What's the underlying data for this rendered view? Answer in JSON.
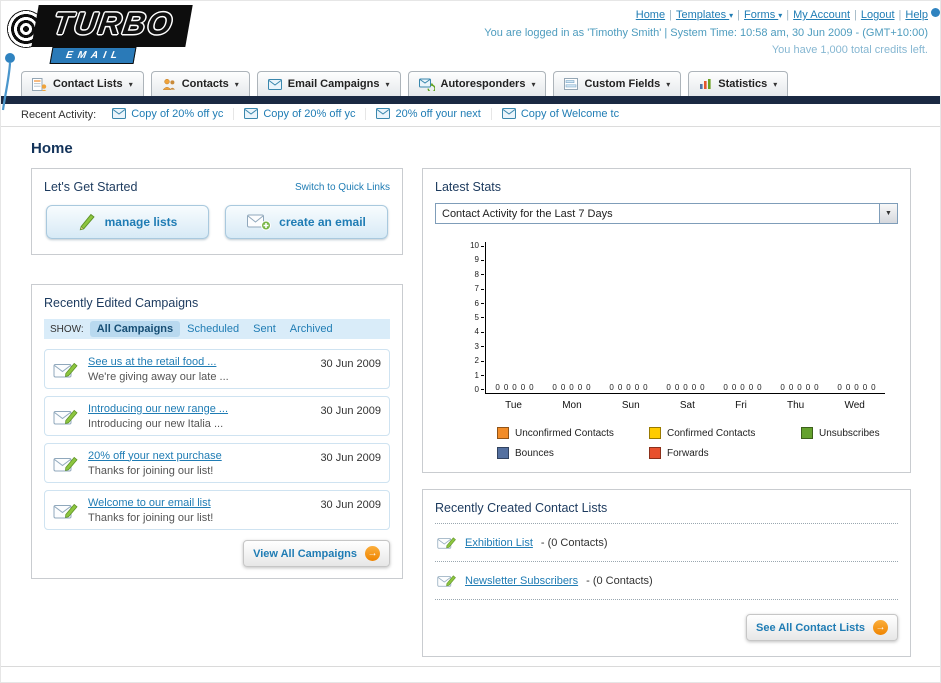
{
  "icons": {
    "caret_down": "▾",
    "select_arrow": "▼",
    "arrow": "→"
  },
  "header": {
    "logo": {
      "title": "TURBO",
      "subtitle": "EMAIL"
    },
    "links": [
      {
        "label": "Home",
        "dropdown": false
      },
      {
        "label": "Templates",
        "dropdown": true
      },
      {
        "label": "Forms",
        "dropdown": true
      },
      {
        "label": "My Account",
        "dropdown": false
      },
      {
        "label": "Logout",
        "dropdown": false
      },
      {
        "label": "Help",
        "dropdown": false
      }
    ],
    "status_line": "You are logged in as 'Timothy Smith' | System Time: 10:58 am, 30 Jun 2009 - (GMT+10:00)",
    "credits_line": "You have 1,000 total credits left."
  },
  "nav_tabs": [
    {
      "label": "Contact Lists",
      "icon": "contact-lists-icon"
    },
    {
      "label": "Contacts",
      "icon": "contacts-icon"
    },
    {
      "label": "Email Campaigns",
      "icon": "email-campaigns-icon"
    },
    {
      "label": "Autoresponders",
      "icon": "autoresponders-icon"
    },
    {
      "label": "Custom Fields",
      "icon": "custom-fields-icon"
    },
    {
      "label": "Statistics",
      "icon": "statistics-icon"
    }
  ],
  "recent_activity": {
    "label": "Recent Activity:",
    "items": [
      "Copy of 20% off yc",
      "Copy of 20% off yc",
      "20% off your next",
      "Copy of Welcome tc"
    ]
  },
  "page_title": "Home",
  "get_started": {
    "title": "Let's Get Started",
    "switch_link": "Switch to Quick Links",
    "buttons": [
      {
        "label": "manage lists"
      },
      {
        "label": "create an email"
      }
    ]
  },
  "campaigns": {
    "title": "Recently Edited Campaigns",
    "show_label": "SHOW:",
    "tabs": [
      "All Campaigns",
      "Scheduled",
      "Sent",
      "Archived"
    ],
    "active_tab": "All Campaigns",
    "rows": [
      {
        "title": "See us at the retail food ...",
        "subtitle": "We're giving away our late ...",
        "date": "30 Jun 2009"
      },
      {
        "title": "Introducing our new range ...",
        "subtitle": "Introducing our new Italia ...",
        "date": "30 Jun 2009"
      },
      {
        "title": "20% off your next purchase",
        "subtitle": "Thanks for joining our list!",
        "date": "30 Jun 2009"
      },
      {
        "title": "Welcome to our email list",
        "subtitle": "Thanks for joining our list!",
        "date": "30 Jun 2009"
      }
    ],
    "view_all_label": "View All Campaigns"
  },
  "stats": {
    "title": "Latest Stats",
    "chart_data": {
      "type": "bar",
      "title": "Contact Activity for the Last 7 Days",
      "categories": [
        "Tue",
        "Mon",
        "Sun",
        "Sat",
        "Fri",
        "Thu",
        "Wed"
      ],
      "series": [
        {
          "name": "Unconfirmed Contacts",
          "color": "#f28c28",
          "values": [
            0,
            0,
            0,
            0,
            0,
            0,
            0
          ]
        },
        {
          "name": "Confirmed Contacts",
          "color": "#ffcc00",
          "values": [
            0,
            0,
            0,
            0,
            0,
            0,
            0
          ]
        },
        {
          "name": "Unsubscribes",
          "color": "#64a12d",
          "values": [
            0,
            0,
            0,
            0,
            0,
            0,
            0
          ]
        },
        {
          "name": "Bounces",
          "color": "#5470a0",
          "values": [
            0,
            0,
            0,
            0,
            0,
            0,
            0
          ]
        },
        {
          "name": "Forwards",
          "color": "#e8502d",
          "values": [
            0,
            0,
            0,
            0,
            0,
            0,
            0
          ]
        }
      ],
      "ylim": [
        0,
        10
      ],
      "yticks": [
        10,
        9,
        8,
        7,
        6,
        5,
        4,
        3,
        2,
        1,
        0
      ],
      "value_labels": true,
      "grid": false,
      "legend_position": "bottom"
    }
  },
  "contact_lists": {
    "title": "Recently Created Contact Lists",
    "items": [
      {
        "name": "Exhibition List",
        "detail": "- (0 Contacts)"
      },
      {
        "name": "Newsletter Subscribers",
        "detail": "- (0 Contacts)"
      }
    ],
    "see_all_label": "See All Contact Lists"
  }
}
